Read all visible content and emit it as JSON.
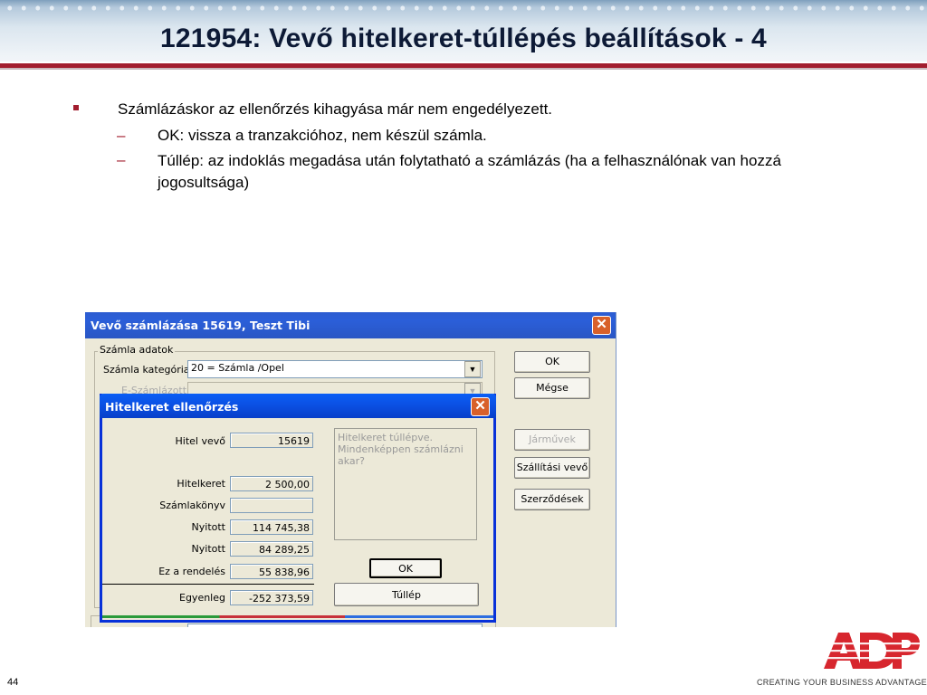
{
  "slide": {
    "title": "121954: Vevő hitelkeret-túllépés beállítások - 4",
    "page_number": "44",
    "tagline": "CREATING YOUR BUSINESS ADVANTAGE",
    "logo_text": "ADP",
    "accent_color": "#a21d2e"
  },
  "bullets": {
    "main": "Számlázáskor az ellenőrzés kihagyása már nem engedélyezett.",
    "dash": "–",
    "sub": [
      "OK: vissza a tranzakcióhoz, nem készül számla.",
      "Túllép: az indoklás megadása után folytatható a számlázás (ha a felhasználónak van hozzá jogosultsága)"
    ]
  },
  "window": {
    "title": "Vevő számlázása 15619, Teszt Tibi",
    "close_icon": "close-icon",
    "group_label": "Számla adatok",
    "category_label": "Számla kategória",
    "category_value": "20 = Számla /Opel",
    "esz_label": "E-Számlázott",
    "buttons": {
      "ok": "OK",
      "cancel": "Mégse",
      "vehicles": "Járművek",
      "shipping": "Szállítási vevő",
      "contracts": "Szerződések"
    }
  },
  "dialog": {
    "title": "Hitelkeret ellenőrzés",
    "message": "Hitelkeret túllépve. Mindenképpen számlázni akar?",
    "fields": [
      {
        "label": "Hitel vevő",
        "value": "15619"
      },
      {
        "label": "Hitelkeret",
        "value": "2 500,00"
      },
      {
        "label": "Számlakönyv",
        "value": ""
      },
      {
        "label": "Nyitott",
        "value": "114 745,38"
      },
      {
        "label": "Nyitott",
        "value": "84 289,25"
      },
      {
        "label": "Ez a rendelés",
        "value": "55 838,96"
      },
      {
        "label": "Egyenleg",
        "value": "-252 373,59"
      }
    ],
    "ok_label": "OK",
    "exceed_label": "Túllép"
  }
}
